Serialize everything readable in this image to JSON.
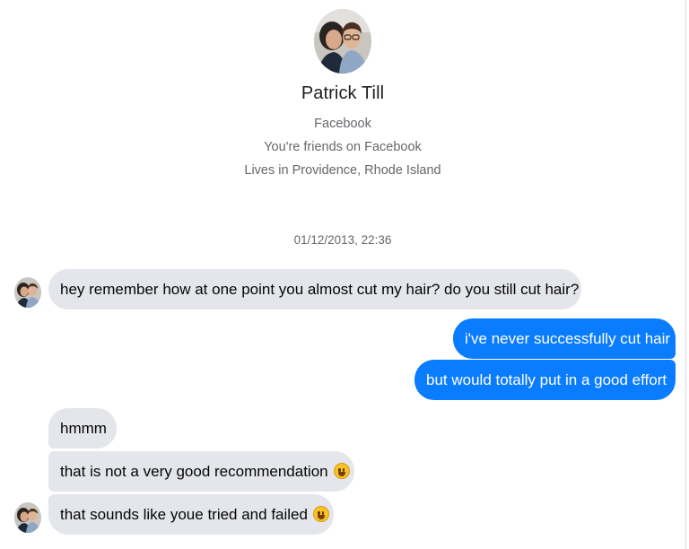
{
  "profile": {
    "name": "Patrick Till",
    "platform": "Facebook",
    "friendship": "You're friends on Facebook",
    "location": "Lives in Providence, Rhode Island"
  },
  "conversation": {
    "timestamp": "01/12/2013, 22:36",
    "messages": [
      {
        "sender": "them",
        "text": "hey remember how at one point you almost cut my hair? do you still cut hair?"
      },
      {
        "sender": "me",
        "text": "i've never successfully cut hair"
      },
      {
        "sender": "me",
        "text": "but would totally put in a good effort"
      },
      {
        "sender": "them",
        "text": "hmmm"
      },
      {
        "sender": "them",
        "text": "that is not a very good recommendation",
        "emoji": "grinning-face"
      },
      {
        "sender": "them",
        "text": "that sounds like youe tried and failed",
        "emoji": "grinning-face"
      }
    ]
  },
  "colors": {
    "incoming_bubble": "#e4e6eb",
    "outgoing_bubble": "#0a7cff",
    "secondary_text": "#65676b"
  }
}
